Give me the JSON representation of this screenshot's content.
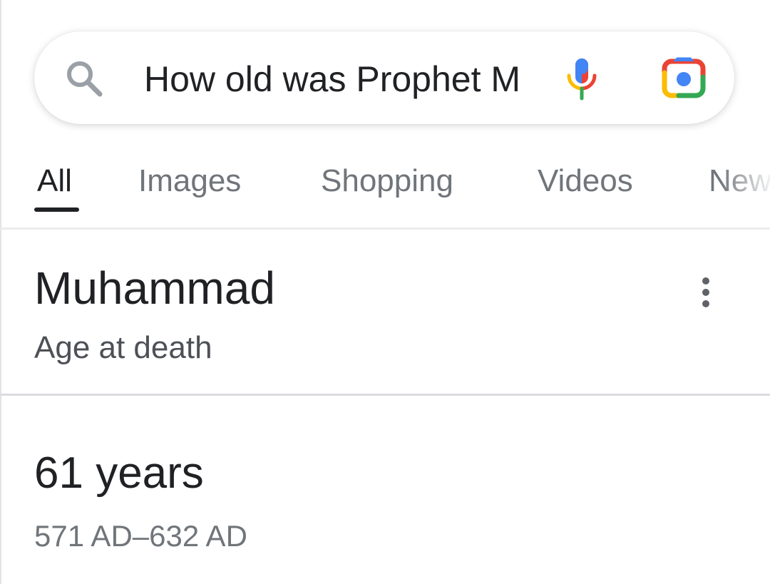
{
  "search": {
    "query": "How old was Prophet M",
    "icons": {
      "search": "search-icon",
      "voice": "microphone-icon",
      "lens": "camera-lens-icon"
    }
  },
  "tabs": [
    {
      "label": "All",
      "active": true
    },
    {
      "label": "Images",
      "active": false
    },
    {
      "label": "Shopping",
      "active": false
    },
    {
      "label": "Videos",
      "active": false
    },
    {
      "label": "News",
      "active": false
    }
  ],
  "result": {
    "title": "Muhammad",
    "subtitle": "Age at death",
    "answer": "61 years",
    "range": "571 AD–632 AD",
    "more_icon": "more-vert-icon"
  },
  "colors": {
    "google_blue": "#4285F4",
    "google_red": "#EA4335",
    "google_yellow": "#FBBC04",
    "google_green": "#34A853",
    "text_primary": "#202124",
    "text_secondary": "#70757a"
  }
}
